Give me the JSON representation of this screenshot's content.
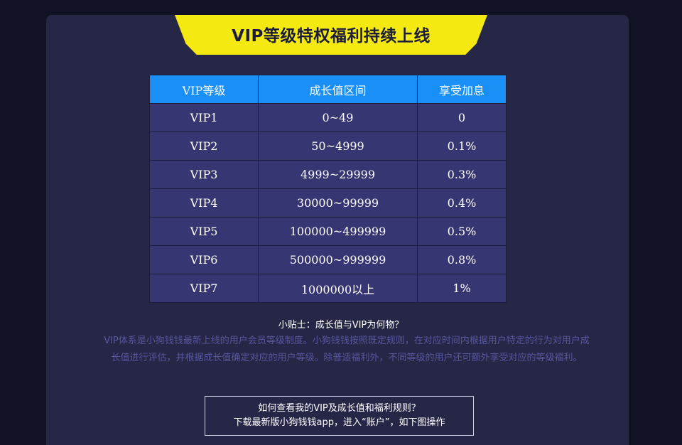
{
  "banner": {
    "title": "VIP等级特权福利持续上线"
  },
  "table": {
    "headers": [
      "VIP等级",
      "成长值区间",
      "享受加息"
    ],
    "rows": [
      [
        "VIP1",
        "0~49",
        "0"
      ],
      [
        "VIP2",
        "50~4999",
        "0.1%"
      ],
      [
        "VIP3",
        "4999~29999",
        "0.3%"
      ],
      [
        "VIP4",
        "30000~99999",
        "0.4%"
      ],
      [
        "VIP5",
        "100000~499999",
        "0.5%"
      ],
      [
        "VIP6",
        "500000~999999",
        "0.8%"
      ],
      [
        "VIP7",
        "1000000以上",
        "1%"
      ]
    ]
  },
  "tip": {
    "title": "小贴士：成长值与VIP为何物？",
    "body": "VIP体系是小狗钱钱最新上线的用户会员等级制度。小狗钱钱按照既定规则，在对应时间内根据用户特定的行为对用户成长值进行评估，并根据成长值确定对应的用户等级。除普适福利外，不同等级的用户还可额外享受对应的等级福利。"
  },
  "howto": {
    "line1": "如何查看我的VIP及成长值和福利规则？",
    "line2": "下载最新版小狗钱钱app，进入“账户”，如下图操作"
  },
  "colors": {
    "background": "#121225",
    "panel": "#262647",
    "banner": "#f4ea12",
    "header_cell": "#1a8ff5",
    "body_cell": "#363672",
    "tip_body_text": "#57579f"
  }
}
